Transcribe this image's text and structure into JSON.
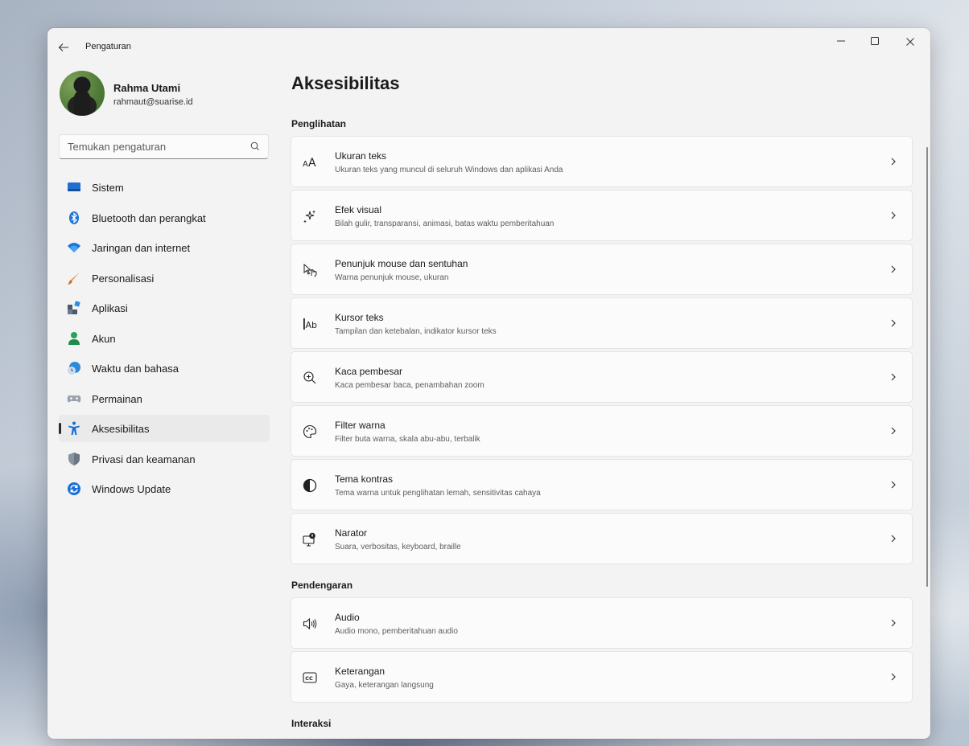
{
  "window": {
    "title": "Pengaturan"
  },
  "profile": {
    "name": "Rahma Utami",
    "email": "rahmaut@suarise.id"
  },
  "search": {
    "placeholder": "Temukan pengaturan"
  },
  "sidebar": {
    "items": [
      {
        "label": "Sistem",
        "icon": "monitor-icon"
      },
      {
        "label": "Bluetooth dan perangkat",
        "icon": "bluetooth-icon"
      },
      {
        "label": "Jaringan dan internet",
        "icon": "wifi-icon"
      },
      {
        "label": "Personalisasi",
        "icon": "brush-icon"
      },
      {
        "label": "Aplikasi",
        "icon": "apps-icon"
      },
      {
        "label": "Akun",
        "icon": "person-icon"
      },
      {
        "label": "Waktu dan bahasa",
        "icon": "globe-clock-icon"
      },
      {
        "label": "Permainan",
        "icon": "gamepad-icon"
      },
      {
        "label": "Aksesibilitas",
        "icon": "accessibility-icon",
        "active": true
      },
      {
        "label": "Privasi dan keamanan",
        "icon": "shield-icon"
      },
      {
        "label": "Windows Update",
        "icon": "update-icon"
      }
    ]
  },
  "main": {
    "title": "Aksesibilitas",
    "sections": [
      {
        "heading": "Penglihatan"
      },
      {
        "heading": "Pendengaran"
      },
      {
        "heading": "Interaksi"
      }
    ],
    "cards": [
      {
        "title": "Ukuran teks",
        "subtitle": "Ukuran teks yang muncul di seluruh Windows dan aplikasi Anda",
        "icon": "text-size-icon"
      },
      {
        "title": "Efek visual",
        "subtitle": "Bilah gulir, transparansi, animasi, batas waktu pemberitahuan",
        "icon": "sparkle-icon"
      },
      {
        "title": "Penunjuk mouse dan sentuhan",
        "subtitle": "Warna penunjuk mouse, ukuran",
        "icon": "pointer-touch-icon"
      },
      {
        "title": "Kursor teks",
        "subtitle": "Tampilan dan ketebalan, indikator kursor teks",
        "icon": "text-cursor-icon"
      },
      {
        "title": "Kaca pembesar",
        "subtitle": "Kaca pembesar baca, penambahan zoom",
        "icon": "magnifier-icon"
      },
      {
        "title": "Filter warna",
        "subtitle": "Filter buta warna, skala abu-abu, terbalik",
        "icon": "palette-icon"
      },
      {
        "title": "Tema kontras",
        "subtitle": "Tema warna untuk penglihatan lemah, sensitivitas cahaya",
        "icon": "contrast-icon"
      },
      {
        "title": "Narator",
        "subtitle": "Suara, verbositas, keyboard, braille",
        "icon": "narrator-icon"
      },
      {
        "title": "Audio",
        "subtitle": "Audio mono, pemberitahuan audio",
        "icon": "speaker-icon"
      },
      {
        "title": "Keterangan",
        "subtitle": "Gaya, keterangan langsung",
        "icon": "captions-icon"
      }
    ]
  },
  "colors": {
    "accent": "#0067c0",
    "window_bg": "#f3f3f3",
    "card_bg": "#fbfbfb"
  }
}
